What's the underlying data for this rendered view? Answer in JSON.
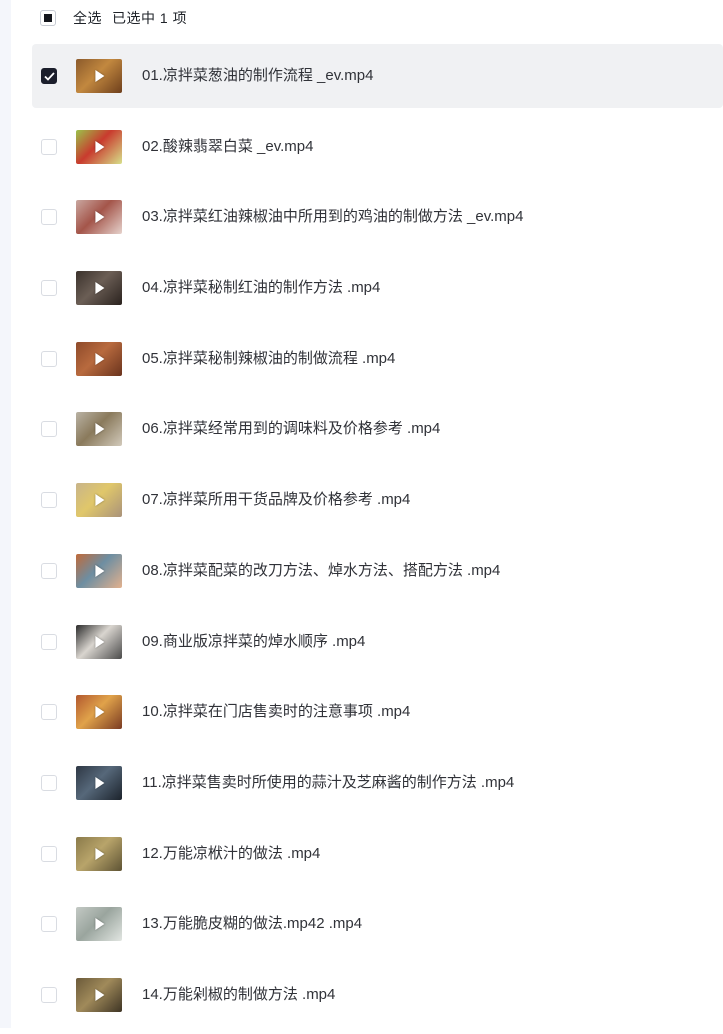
{
  "header": {
    "select_all": "全选",
    "selected_text": "已选中 1 项"
  },
  "files": [
    {
      "name": "01.凉拌菜葱油的制作流程 _ev.mp4",
      "checked": true,
      "thumb": [
        "#8b5a2b",
        "#c2883f",
        "#6e3f1c"
      ]
    },
    {
      "name": "02.酸辣翡翠白菜 _ev.mp4",
      "checked": false,
      "thumb": [
        "#9bc24a",
        "#c93b2e",
        "#d7e08a"
      ]
    },
    {
      "name": "03.凉拌菜红油辣椒油中所用到的鸡油的制做方法 _ev.mp4",
      "checked": false,
      "thumb": [
        "#c9a7a0",
        "#a4554a",
        "#e6d2cc"
      ]
    },
    {
      "name": "04.凉拌菜秘制红油的制作方法 .mp4",
      "checked": false,
      "thumb": [
        "#3b322c",
        "#6b5e55",
        "#2a221e"
      ]
    },
    {
      "name": "05.凉拌菜秘制辣椒油的制做流程 .mp4",
      "checked": false,
      "thumb": [
        "#8e4a2a",
        "#b86a3e",
        "#6a331d"
      ]
    },
    {
      "name": "06.凉拌菜经常用到的调味料及价格参考 .mp4",
      "checked": false,
      "thumb": [
        "#b9b2a4",
        "#8a7a5c",
        "#d2cabb"
      ]
    },
    {
      "name": "07.凉拌菜所用干货品牌及价格参考 .mp4",
      "checked": false,
      "thumb": [
        "#c8b48a",
        "#e0c76a",
        "#a9927a"
      ]
    },
    {
      "name": "08.凉拌菜配菜的改刀方法、焯水方法、搭配方法 .mp4",
      "checked": false,
      "thumb": [
        "#c06a3a",
        "#6d8ea2",
        "#e2b18e"
      ]
    },
    {
      "name": "09.商业版凉拌菜的焯水顺序 .mp4",
      "checked": false,
      "thumb": [
        "#2a2a2a",
        "#d9d5cf",
        "#4a4a4a"
      ]
    },
    {
      "name": "10.凉拌菜在门店售卖时的注意事项 .mp4",
      "checked": false,
      "thumb": [
        "#b2582e",
        "#e0a24a",
        "#7a3b22"
      ]
    },
    {
      "name": "11.凉拌菜售卖时所使用的蒜汁及芝麻酱的制作方法 .mp4",
      "checked": false,
      "thumb": [
        "#2e3744",
        "#56687a",
        "#1c232c"
      ]
    },
    {
      "name": "12.万能凉栿汁的做法 .mp4",
      "checked": false,
      "thumb": [
        "#8a7a4a",
        "#b8a46a",
        "#5e5334"
      ]
    },
    {
      "name": "13.万能脆皮糊的做法.mp42 .mp4",
      "checked": false,
      "thumb": [
        "#c3c9c4",
        "#9aa59e",
        "#e2e6e2"
      ]
    },
    {
      "name": "14.万能剁椒的制做方法 .mp4",
      "checked": false,
      "thumb": [
        "#6b5a3a",
        "#a08a5a",
        "#3e3424"
      ]
    }
  ],
  "colors": {
    "selected_row_bg": "#f0f1f3",
    "checkbox_checked": "#1b1e2b"
  }
}
